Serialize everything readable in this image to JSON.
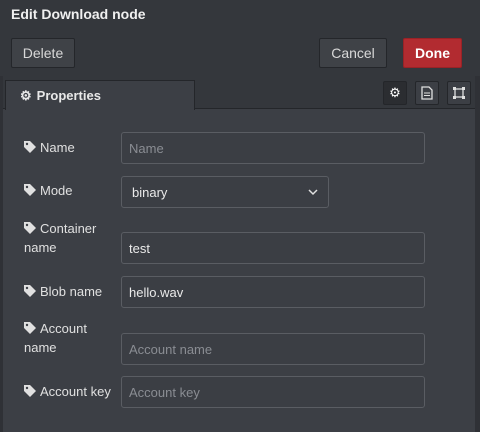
{
  "header": {
    "title": "Edit Download node"
  },
  "toolbar": {
    "delete_label": "Delete",
    "cancel_label": "Cancel",
    "done_label": "Done"
  },
  "tabs": {
    "properties_label": "Properties"
  },
  "tab_icons": [
    "gear-icon",
    "document-icon",
    "frame-icon"
  ],
  "form": {
    "name": {
      "label": "Name",
      "value": "",
      "placeholder": "Name"
    },
    "mode": {
      "label": "Mode",
      "value": "binary"
    },
    "container": {
      "label_line1": "Container",
      "label_line2": "name",
      "value": "test"
    },
    "blob": {
      "label": "Blob name",
      "value": "hello.wav"
    },
    "account_name": {
      "label_line1": "Account",
      "label_line2": "name",
      "value": "",
      "placeholder": "Account name"
    },
    "account_key": {
      "label": "Account key",
      "value": "",
      "placeholder": "Account key"
    }
  },
  "colors": {
    "done_button": "#b22b30",
    "background": "#3c3f45",
    "toolbar": "#34373c"
  }
}
